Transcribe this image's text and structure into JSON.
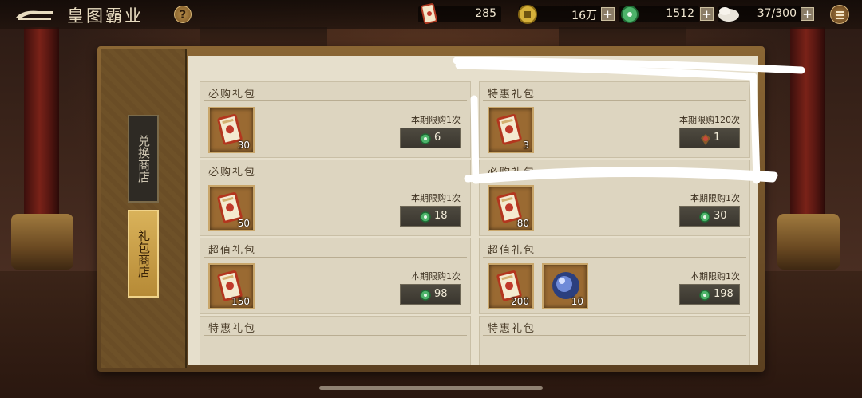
{
  "header": {
    "title": "皇图霸业",
    "help_label": "?",
    "resources": [
      {
        "icon": "gift-scroll-icon",
        "value": "285"
      },
      {
        "icon": "gold-coin-icon",
        "value": "16万"
      },
      {
        "icon": "jade-icon",
        "value": "1512"
      },
      {
        "icon": "stamina-icon",
        "value": "37/300"
      }
    ],
    "plus_label": "+"
  },
  "sidebar": {
    "tabs": [
      {
        "label": "兑换商店",
        "selected": false
      },
      {
        "label": "礼包商店",
        "selected": true
      }
    ]
  },
  "shop": {
    "packs": [
      {
        "name": "必购礼包",
        "items": [
          {
            "icon": "gift-scroll-icon",
            "qty": "30"
          }
        ],
        "limit": "本期限购1次",
        "currency": "jade-icon",
        "price": "6"
      },
      {
        "name": "特惠礼包",
        "items": [
          {
            "icon": "gift-scroll-icon",
            "qty": "3"
          }
        ],
        "limit": "本期限购120次",
        "currency": "token-icon",
        "price": "1"
      },
      {
        "name": "必购礼包",
        "items": [
          {
            "icon": "gift-scroll-icon",
            "qty": "50"
          }
        ],
        "limit": "本期限购1次",
        "currency": "jade-icon",
        "price": "18"
      },
      {
        "name": "必购礼包",
        "items": [
          {
            "icon": "gift-scroll-icon",
            "qty": "80"
          }
        ],
        "limit": "本期限购1次",
        "currency": "jade-icon",
        "price": "30"
      },
      {
        "name": "超值礼包",
        "items": [
          {
            "icon": "gift-scroll-icon",
            "qty": "150"
          }
        ],
        "limit": "本期限购1次",
        "currency": "jade-icon",
        "price": "98"
      },
      {
        "name": "超值礼包",
        "items": [
          {
            "icon": "gift-scroll-icon",
            "qty": "200"
          },
          {
            "icon": "blue-orb-icon",
            "qty": "10"
          }
        ],
        "limit": "本期限购1次",
        "currency": "jade-icon",
        "price": "198"
      },
      {
        "name": "特惠礼包",
        "items": [],
        "limit": "",
        "currency": "",
        "price": ""
      },
      {
        "name": "特惠礼包",
        "items": [],
        "limit": "",
        "currency": "",
        "price": ""
      }
    ]
  },
  "colors": {
    "accent": "#b68a36",
    "panel": "#e6dfcc",
    "jade": "#3fa05a",
    "annotation": "#ffffff"
  }
}
